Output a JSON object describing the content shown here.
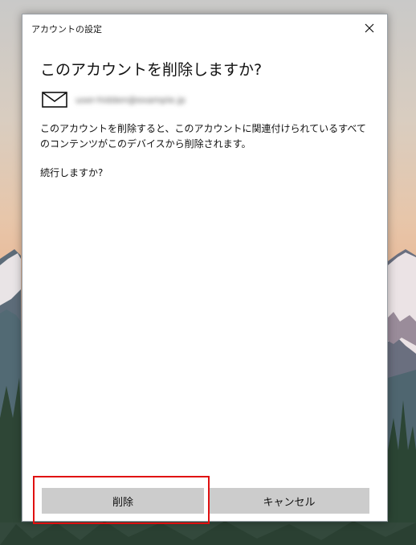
{
  "window": {
    "title": "アカウントの設定"
  },
  "dialog": {
    "heading": "このアカウントを削除しますか?",
    "account_email": "user-hidden@example.jp",
    "description": "このアカウントを削除すると、このアカウントに関連付けられているすべてのコンテンツがこのデバイスから削除されます。",
    "confirm_prompt": "続行しますか?"
  },
  "buttons": {
    "delete_label": "削除",
    "cancel_label": "キャンセル"
  },
  "icons": {
    "close": "close-icon",
    "account": "mail-icon"
  },
  "colors": {
    "button_bg": "#cccccc",
    "highlight": "#e01010"
  }
}
